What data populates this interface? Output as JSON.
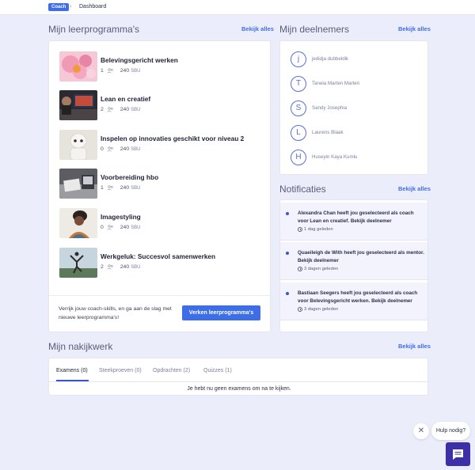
{
  "breadcrumb": {
    "badge": "Coach",
    "separator": "›",
    "current": "Dashboard"
  },
  "programs": {
    "title": "Mijn leerprogramma's",
    "see_all": "Bekijk alles",
    "items": [
      {
        "title": "Belevingsgericht werken",
        "participants": "1",
        "sbu": "240",
        "sbu_label": "SBU"
      },
      {
        "title": "Lean en creatief",
        "participants": "2",
        "sbu": "240",
        "sbu_label": "SBU"
      },
      {
        "title": "Inspelen op innovaties geschikt voor niveau 2",
        "participants": "0",
        "sbu": "240",
        "sbu_label": "SBU"
      },
      {
        "title": "Voorbereiding hbo",
        "participants": "1",
        "sbu": "240",
        "sbu_label": "SBU"
      },
      {
        "title": "Imagestyling",
        "participants": "0",
        "sbu": "240",
        "sbu_label": "SBU"
      },
      {
        "title": "Werkgeluk: Succesvol samenwerken",
        "participants": "2",
        "sbu": "240",
        "sbu_label": "SBU"
      }
    ],
    "cta_text": "Verrijk jouw coach-skills, en ga aan de slag met nieuwe leerprogramma's!",
    "cta_button": "Verken leerprogramma's"
  },
  "participants": {
    "title": "Mijn deelnemers",
    "see_all": "Bekijk alles",
    "items": [
      {
        "initial": "j",
        "name": "jedidja dubbeldik"
      },
      {
        "initial": "T",
        "name": "Taneia Marten Marten"
      },
      {
        "initial": "S",
        "name": "Sandy Josephia"
      },
      {
        "initial": "L",
        "name": "Laurens Blaak"
      },
      {
        "initial": "H",
        "name": "Huseyin Kaya Kumlu"
      }
    ]
  },
  "notifications": {
    "title": "Notificaties",
    "see_all": "Bekijk alles",
    "items": [
      {
        "text": "Alexandra Chan heeft jou geselecteerd als coach voor Lean en creatief. Bekijk deelnemer",
        "time": "1 dag geleden"
      },
      {
        "text": "Quaeileigh de With heeft jou geselecteerd als mentor. Bekijk deelnemer",
        "time": "3 dagen geleden"
      },
      {
        "text": "Bastiaan Seegers heeft jou geselecteerd als coach voor Belevingsgericht werken. Bekijk deelnemer",
        "time": "3 dagen geleden"
      }
    ]
  },
  "review": {
    "title": "Mijn nakijkwerk",
    "see_all": "Bekijk alles",
    "tabs": [
      {
        "label": "Examens (0)",
        "active": true
      },
      {
        "label": "Steekproeven (0)",
        "active": false
      },
      {
        "label": "Opdrachten (2)",
        "active": false
      },
      {
        "label": "Quizzes (1)",
        "active": false
      }
    ],
    "empty_message": "Je hebt nu geen examens om na te kijken."
  },
  "help": {
    "close": "✕",
    "label": "Hulp nodig?",
    "chat_icon": "chat-icon"
  },
  "colors": {
    "accent": "#3d6ee8",
    "background": "#ecedfb",
    "chat": "#3d2fa8",
    "avatar_ring": "#5a6ed6"
  }
}
